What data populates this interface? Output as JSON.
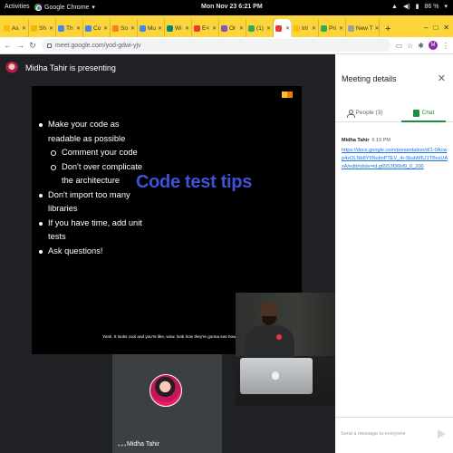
{
  "topbar": {
    "activities": "Activities",
    "app": "Google Chrome",
    "clock": "Mon Nov 23  6:21 PM",
    "battery": "86 %"
  },
  "tabs": [
    {
      "label": "As",
      "color": "#fbbc04"
    },
    {
      "label": "Sh",
      "color": "#f4b400"
    },
    {
      "label": "Th",
      "color": "#4285f4"
    },
    {
      "label": "Co",
      "color": "#4285f4"
    },
    {
      "label": "So",
      "color": "#f48024"
    },
    {
      "label": "Mu",
      "color": "#4285f4"
    },
    {
      "label": "Wi",
      "color": "#00897b"
    },
    {
      "label": "E<",
      "color": "#e53935"
    },
    {
      "label": "Or",
      "color": "#7e57c2"
    },
    {
      "label": "(1)",
      "color": "#34a853"
    },
    {
      "label": "",
      "color": "#e53935"
    },
    {
      "label": "Inl",
      "color": "#fbbc04"
    },
    {
      "label": "Pri",
      "color": "#34a853"
    },
    {
      "label": "New T",
      "color": "#9e9e9e"
    }
  ],
  "address": {
    "url": "meet.google.com/yod-gdwi-yjv"
  },
  "meet": {
    "presenter_text": "Midha Tahir is presenting",
    "slide": {
      "bullets": [
        {
          "level": "l1",
          "text": "Make your code as"
        },
        {
          "level": "cont",
          "text": "readable as possible"
        },
        {
          "level": "l2",
          "text": "Comment your code"
        },
        {
          "level": "l2",
          "text": "Don't over complicate"
        },
        {
          "level": "cont2",
          "text": "the architecture"
        },
        {
          "level": "l1",
          "text": "Don't import too many"
        },
        {
          "level": "cont",
          "text": "libraries"
        },
        {
          "level": "l1",
          "text": "If you have time, add unit"
        },
        {
          "level": "cont",
          "text": "tests"
        },
        {
          "level": "l1",
          "text": "Ask questions!"
        }
      ],
      "title": "Code test tips"
    },
    "caption": "Yeah. It looks cool and you're like, wow, look how they're gonna see how smart I am.",
    "tile_name": "Midha Tahir"
  },
  "panel": {
    "title": "Meeting details",
    "people_tab": "People (3)",
    "chat_tab": "Chat",
    "message": {
      "sender": "Midha Tahir",
      "time": "6:19 PM",
      "link": "https://docs.google.com/presentation/d/1-0Acwp4xOLNb8Y9NolmPTEV_4r-5ksbM5J1TBxsUAxA/edit#slide=id.g6553f36bf9_0_200"
    },
    "compose_placeholder": "Send a message to everyone"
  }
}
